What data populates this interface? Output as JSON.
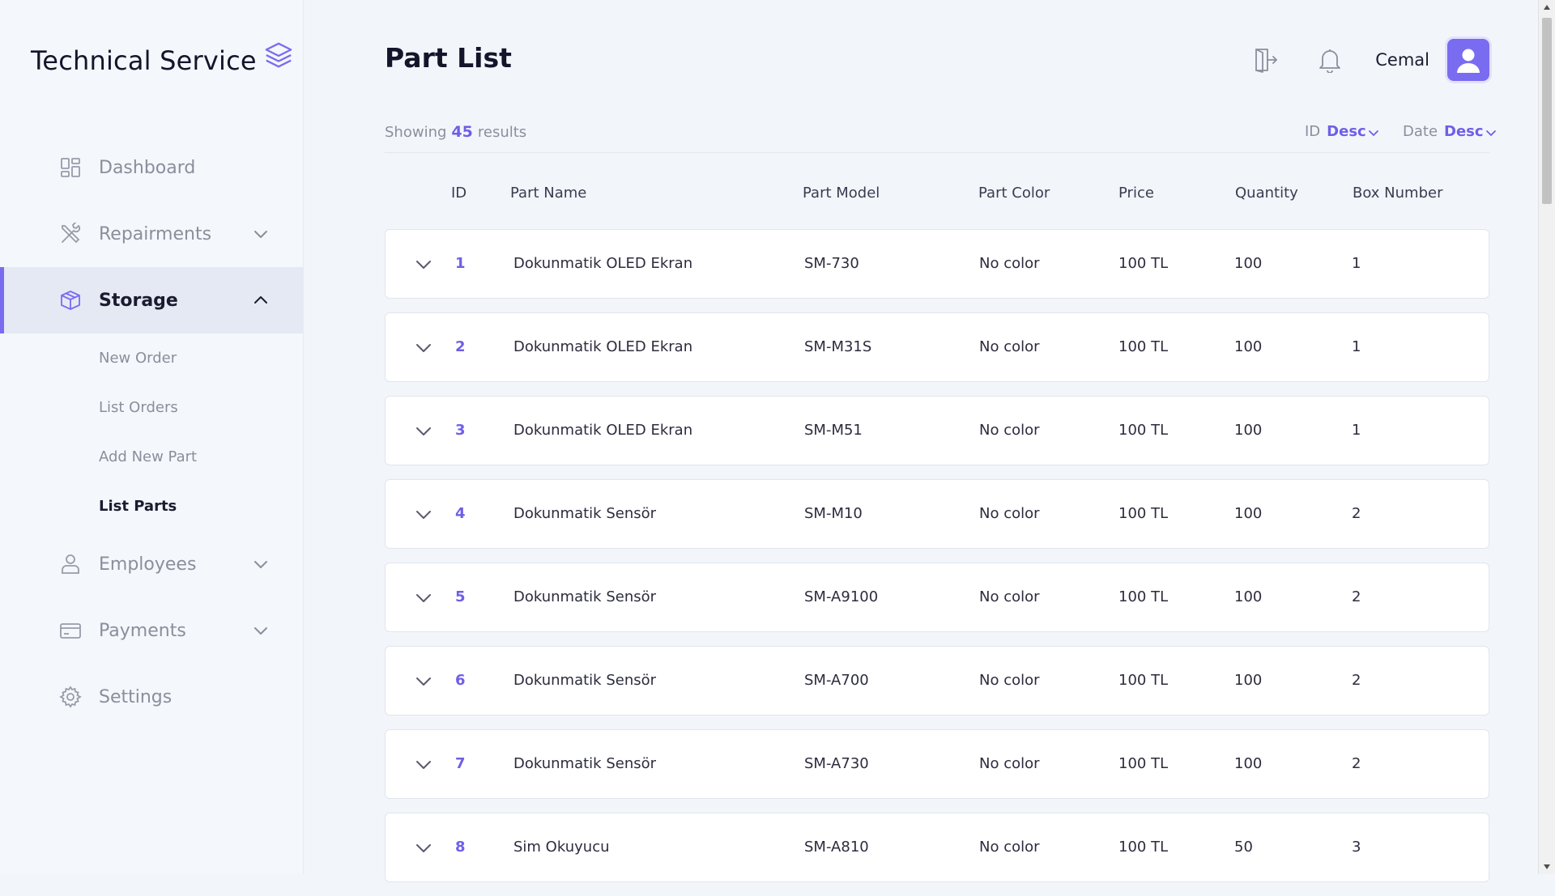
{
  "app": {
    "title": "Technical Service",
    "accent_color": "#7a6cf0",
    "logo_icon": "layers-icon"
  },
  "sidebar": {
    "items": [
      {
        "label": "Dashboard",
        "icon": "dashboard-icon"
      },
      {
        "label": "Repairments",
        "icon": "tools-icon"
      },
      {
        "label": "Storage",
        "icon": "box-icon"
      },
      {
        "label": "Employees",
        "icon": "user-icon"
      },
      {
        "label": "Payments",
        "icon": "credit-card-icon"
      },
      {
        "label": "Settings",
        "icon": "gear-icon"
      }
    ],
    "storage_sub": [
      {
        "label": "New Order"
      },
      {
        "label": "List Orders"
      },
      {
        "label": "Add New Part"
      },
      {
        "label": "List Parts"
      }
    ]
  },
  "header": {
    "title": "Part List",
    "username": "Cemal",
    "logout_icon": "logout-icon",
    "notification_icon": "bell-icon"
  },
  "results": {
    "prefix": "Showing",
    "count": "45",
    "suffix": "results"
  },
  "sort": {
    "id_label": "ID",
    "id_value": "Desc",
    "date_label": "Date",
    "date_value": "Desc"
  },
  "table": {
    "columns": [
      "ID",
      "Part Name",
      "Part Model",
      "Part Color",
      "Price",
      "Quantity",
      "Box Number"
    ],
    "rows": [
      {
        "id": "1",
        "name": "Dokunmatik OLED Ekran",
        "model": "SM-730",
        "color": "No color",
        "price": "100 TL",
        "quantity": "100",
        "box": "1"
      },
      {
        "id": "2",
        "name": "Dokunmatik OLED Ekran",
        "model": "SM-M31S",
        "color": "No color",
        "price": "100 TL",
        "quantity": "100",
        "box": "1"
      },
      {
        "id": "3",
        "name": "Dokunmatik OLED Ekran",
        "model": "SM-M51",
        "color": "No color",
        "price": "100 TL",
        "quantity": "100",
        "box": "1"
      },
      {
        "id": "4",
        "name": "Dokunmatik Sensör",
        "model": "SM-M10",
        "color": "No color",
        "price": "100 TL",
        "quantity": "100",
        "box": "2"
      },
      {
        "id": "5",
        "name": "Dokunmatik Sensör",
        "model": "SM-A9100",
        "color": "No color",
        "price": "100 TL",
        "quantity": "100",
        "box": "2"
      },
      {
        "id": "6",
        "name": "Dokunmatik Sensör",
        "model": "SM-A700",
        "color": "No color",
        "price": "100 TL",
        "quantity": "100",
        "box": "2"
      },
      {
        "id": "7",
        "name": "Dokunmatik Sensör",
        "model": "SM-A730",
        "color": "No color",
        "price": "100 TL",
        "quantity": "100",
        "box": "2"
      },
      {
        "id": "8",
        "name": "Sim Okuyucu",
        "model": "SM-A810",
        "color": "No color",
        "price": "100 TL",
        "quantity": "50",
        "box": "3"
      }
    ]
  }
}
